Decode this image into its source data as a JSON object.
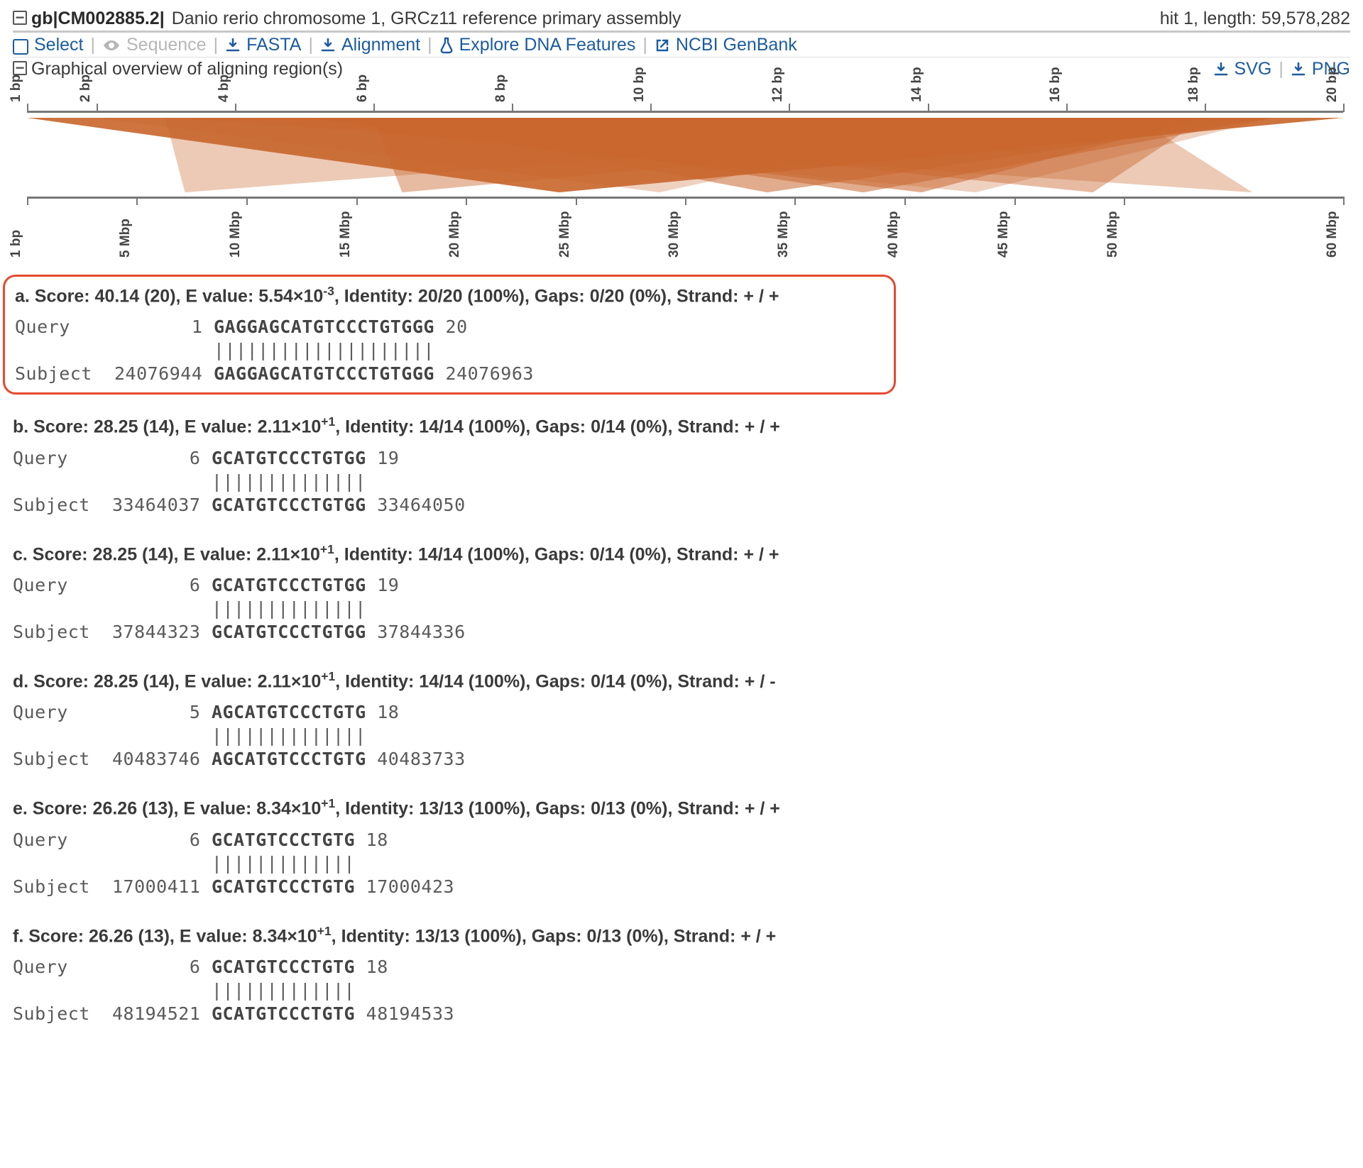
{
  "header": {
    "source_prefix": "gb|",
    "accession": "CM002885.2",
    "source_suffix": "|",
    "title": "Danio rerio chromosome 1, GRCz11 reference primary assembly",
    "hit_label": "hit 1, length: 59,578,282"
  },
  "toolbar": {
    "select": "Select",
    "sequence": "Sequence",
    "fasta": "FASTA",
    "alignment": "Alignment",
    "explore": "Explore DNA Features",
    "genbank": "NCBI GenBank"
  },
  "overview": {
    "label": "Graphical overview of aligning region(s)",
    "svg": "SVG",
    "png": "PNG"
  },
  "axes": {
    "top": [
      "1 bp",
      "2 bp",
      "4 bp",
      "6 bp",
      "8 bp",
      "10 bp",
      "12 bp",
      "14 bp",
      "16 bp",
      "18 bp",
      "20 bp"
    ],
    "top_pos": [
      0,
      5.26,
      15.79,
      26.32,
      36.84,
      47.37,
      57.89,
      68.42,
      78.95,
      89.47,
      100
    ],
    "bottom": [
      "1 bp",
      "5 Mbp",
      "10 Mbp",
      "15 Mbp",
      "20 Mbp",
      "25 Mbp",
      "30 Mbp",
      "35 Mbp",
      "40 Mbp",
      "45 Mbp",
      "50 Mbp",
      "60 Mbp"
    ],
    "bottom_pos": [
      0,
      8.33,
      16.67,
      25,
      33.33,
      41.67,
      50,
      58.33,
      66.67,
      75,
      83.33,
      100
    ]
  },
  "polys": [
    {
      "qs": 0,
      "qe": 100,
      "ss": 40.4,
      "se": 40.5,
      "op": 0.92
    },
    {
      "qs": 26.3,
      "qe": 94.7,
      "ss": 56.2,
      "se": 56.3,
      "op": 0.55
    },
    {
      "qs": 26.3,
      "qe": 94.7,
      "ss": 63.5,
      "se": 63.6,
      "op": 0.55
    },
    {
      "qs": 21.1,
      "qe": 89.5,
      "ss": 67.9,
      "se": 68.0,
      "op": 0.55
    },
    {
      "qs": 26.3,
      "qe": 89.5,
      "ss": 28.5,
      "se": 28.6,
      "op": 0.45
    },
    {
      "qs": 26.3,
      "qe": 89.5,
      "ss": 80.9,
      "se": 81.0,
      "op": 0.45
    },
    {
      "qs": 10.5,
      "qe": 84.2,
      "ss": 12.0,
      "se": 12.1,
      "op": 0.35
    },
    {
      "qs": 10.5,
      "qe": 84.2,
      "ss": 93.0,
      "se": 93.1,
      "op": 0.35
    },
    {
      "qs": 5.3,
      "qe": 73.7,
      "ss": 48.0,
      "se": 48.1,
      "op": 0.3
    },
    {
      "qs": 15.8,
      "qe": 94.7,
      "ss": 72.0,
      "se": 72.1,
      "op": 0.3
    }
  ],
  "alignments": [
    {
      "letter": "a",
      "highlight": true,
      "score": "40.14 (20)",
      "evalue_base": "5.54×10",
      "evalue_exp": "-3",
      "identity": "20/20 (100%)",
      "gaps": "0/20 (0%)",
      "strand": "+ / +",
      "query_start": "1",
      "query_seq": "GAGGAGCATGTCCCTGTGGG",
      "query_end": "20",
      "match": "||||||||||||||||||||",
      "subject_start": "24076944",
      "subject_seq": "GAGGAGCATGTCCCTGTGGG",
      "subject_end": "24076963"
    },
    {
      "letter": "b",
      "score": "28.25 (14)",
      "evalue_base": "2.11×10",
      "evalue_exp": "+1",
      "identity": "14/14 (100%)",
      "gaps": "0/14 (0%)",
      "strand": "+ / +",
      "query_start": "6",
      "query_seq": "GCATGTCCCTGTGG",
      "query_end": "19",
      "match": "||||||||||||||",
      "subject_start": "33464037",
      "subject_seq": "GCATGTCCCTGTGG",
      "subject_end": "33464050"
    },
    {
      "letter": "c",
      "score": "28.25 (14)",
      "evalue_base": "2.11×10",
      "evalue_exp": "+1",
      "identity": "14/14 (100%)",
      "gaps": "0/14 (0%)",
      "strand": "+ / +",
      "query_start": "6",
      "query_seq": "GCATGTCCCTGTGG",
      "query_end": "19",
      "match": "||||||||||||||",
      "subject_start": "37844323",
      "subject_seq": "GCATGTCCCTGTGG",
      "subject_end": "37844336"
    },
    {
      "letter": "d",
      "score": "28.25 (14)",
      "evalue_base": "2.11×10",
      "evalue_exp": "+1",
      "identity": "14/14 (100%)",
      "gaps": "0/14 (0%)",
      "strand": "+ / -",
      "query_start": "5",
      "query_seq": "AGCATGTCCCTGTG",
      "query_end": "18",
      "match": "||||||||||||||",
      "subject_start": "40483746",
      "subject_seq": "AGCATGTCCCTGTG",
      "subject_end": "40483733"
    },
    {
      "letter": "e",
      "score": "26.26 (13)",
      "evalue_base": "8.34×10",
      "evalue_exp": "+1",
      "identity": "13/13 (100%)",
      "gaps": "0/13 (0%)",
      "strand": "+ / +",
      "query_start": "6",
      "query_seq": "GCATGTCCCTGTG",
      "query_end": "18",
      "match": "|||||||||||||",
      "subject_start": "17000411",
      "subject_seq": "GCATGTCCCTGTG",
      "subject_end": "17000423"
    },
    {
      "letter": "f",
      "score": "26.26 (13)",
      "evalue_base": "8.34×10",
      "evalue_exp": "+1",
      "identity": "13/13 (100%)",
      "gaps": "0/13 (0%)",
      "strand": "+ / +",
      "query_start": "6",
      "query_seq": "GCATGTCCCTGTG",
      "query_end": "18",
      "match": "|||||||||||||",
      "subject_start": "48194521",
      "subject_seq": "GCATGTCCCTGTG",
      "subject_end": "48194533"
    }
  ],
  "labels": {
    "query": "Query",
    "subject": "Subject"
  }
}
